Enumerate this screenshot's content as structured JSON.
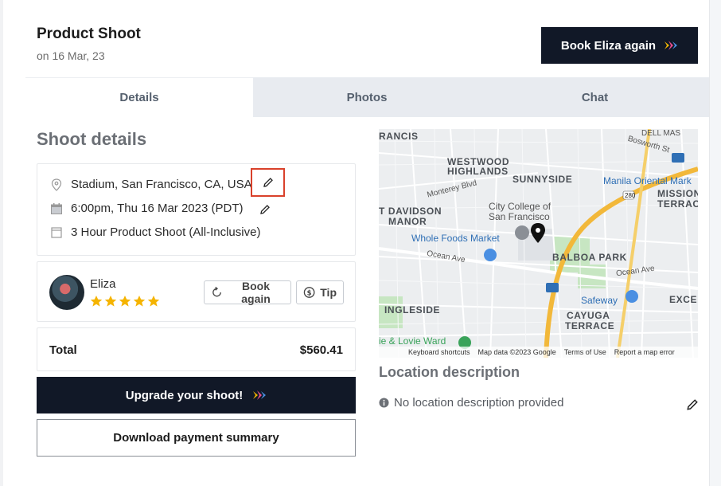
{
  "header": {
    "title": "Product Shoot",
    "subtitle": "on 16 Mar, 23",
    "book_again_label": "Book Eliza again"
  },
  "tabs": [
    {
      "label": "Details",
      "active": true
    },
    {
      "label": "Photos",
      "active": false
    },
    {
      "label": "Chat",
      "active": false
    }
  ],
  "shoot_details": {
    "title": "Shoot details",
    "location": "Stadium, San Francisco, CA, USA",
    "datetime": "6:00pm, Thu 16 Mar 2023 (PDT)",
    "package": "3 Hour Product Shoot (All-Inclusive)"
  },
  "photographer": {
    "name": "Eliza",
    "rating": 5,
    "book_again_label": "Book again",
    "tip_label": "Tip"
  },
  "total": {
    "label": "Total",
    "value": "$560.41"
  },
  "actions": {
    "upgrade_label": "Upgrade your shoot!",
    "download_label": "Download payment summary"
  },
  "map": {
    "labels": {
      "francis": "RANCIS",
      "westwood": "WESTWOOD",
      "highlands": "HIGHLANDS",
      "sunnyside": "SUNNYSIDE",
      "manila": "Manila Oriental Mark",
      "mission": "MISSION",
      "terrace": "TERRAC",
      "davidson": "T DAVIDSON",
      "manor": "MANOR",
      "city_college_1": "City College of",
      "city_college_2": "San Francisco",
      "whole_foods": "Whole Foods Market",
      "balboa": "BALBOA PARK",
      "ocean_ave_1": "Ocean Ave",
      "ocean_ave_2": "Ocean Ave",
      "monterey": "Monterey Blvd",
      "bosworth": "Bosworth St",
      "safeway": "Safeway",
      "exce": "EXCE",
      "ingleside": "INGLESIDE",
      "cayuga_1": "CAYUGA",
      "cayuga_2": "TERRACE",
      "lovie": "ie & Lovie Ward",
      "dell": "DELL MAS",
      "hwy_280": "280",
      "hwy_1": "1"
    },
    "footer": {
      "shortcuts": "Keyboard shortcuts",
      "data": "Map data ©2023 Google",
      "terms": "Terms of Use",
      "report": "Report a map error"
    }
  },
  "location_description": {
    "title": "Location description",
    "text": "No location description provided"
  },
  "colors": {
    "dark": "#111827",
    "highlight": "#d9412b",
    "star": "#f5b400",
    "map_road": "#f2b83a"
  }
}
